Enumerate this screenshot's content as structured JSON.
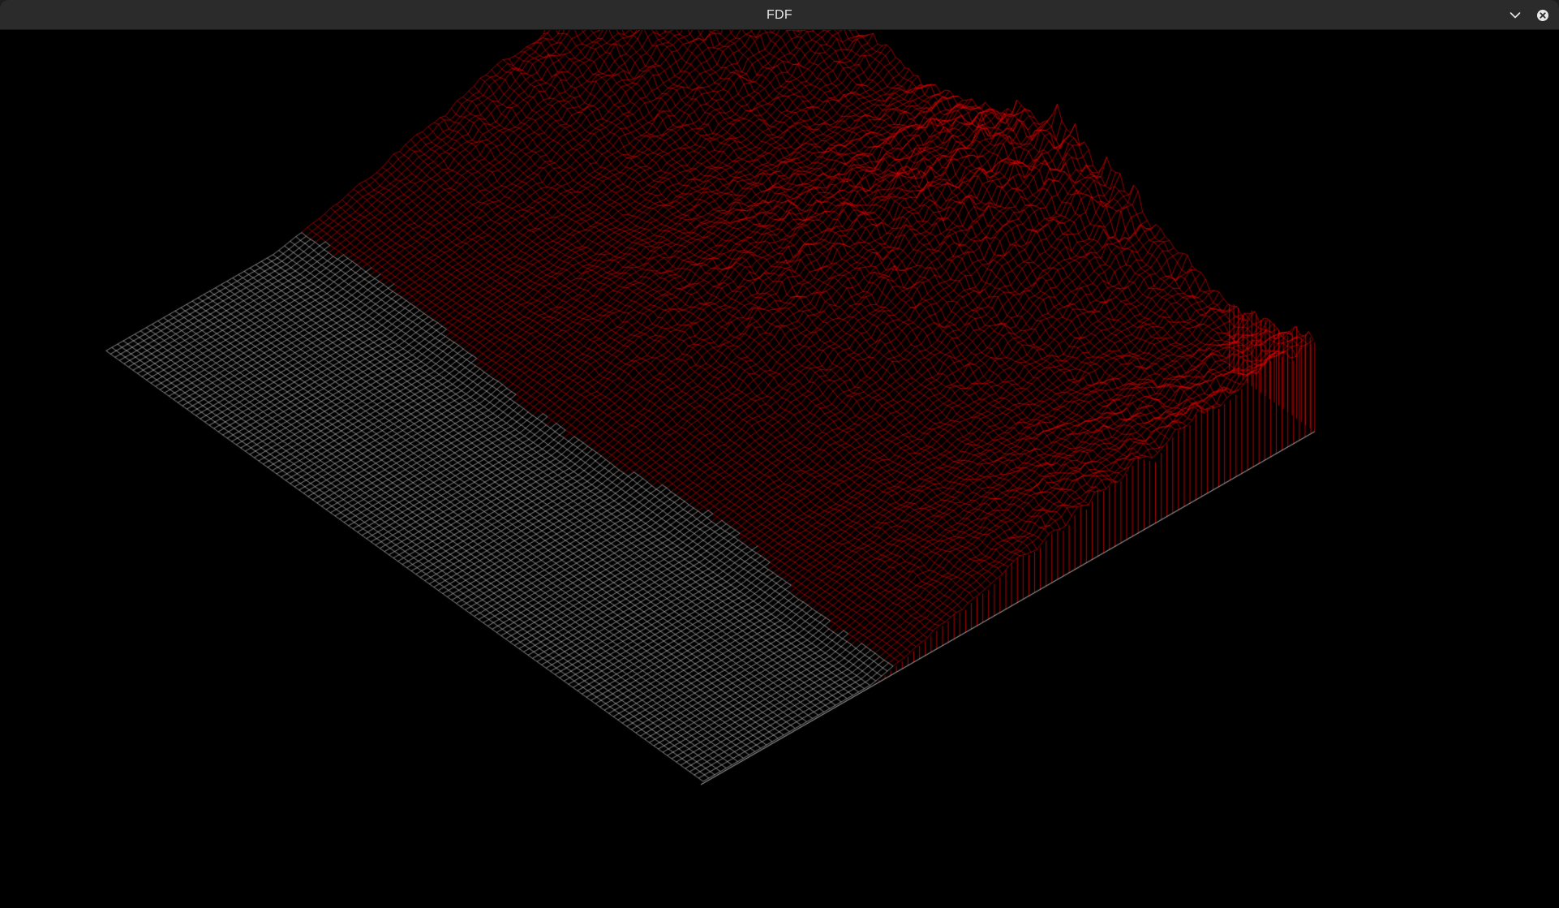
{
  "window": {
    "title": "FDF",
    "menu_icon": "chevron-down-icon",
    "close_icon": "close-icon"
  },
  "render": {
    "background": "#000000",
    "low_color": "#e6e6e6",
    "high_color": "#ff0000",
    "projection": "isometric",
    "style": "wireframe"
  }
}
